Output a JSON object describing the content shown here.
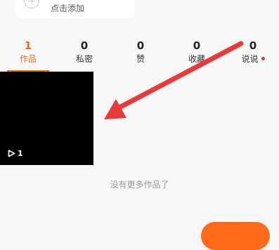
{
  "add_card": {
    "label": "点击添加"
  },
  "tabs": [
    {
      "count": "1",
      "label": "作品",
      "active": true
    },
    {
      "count": "0",
      "label": "私密",
      "active": false
    },
    {
      "count": "0",
      "label": "赞",
      "active": false
    },
    {
      "count": "0",
      "label": "收藏",
      "active": false
    },
    {
      "count": "0",
      "label": "说说",
      "active": false
    }
  ],
  "video": {
    "play_count": "1"
  },
  "no_more_text": "没有更多作品了",
  "colors": {
    "accent": "#ef6a1e",
    "arrow": "#e83a3a",
    "notification_dot": "#ee3333"
  }
}
